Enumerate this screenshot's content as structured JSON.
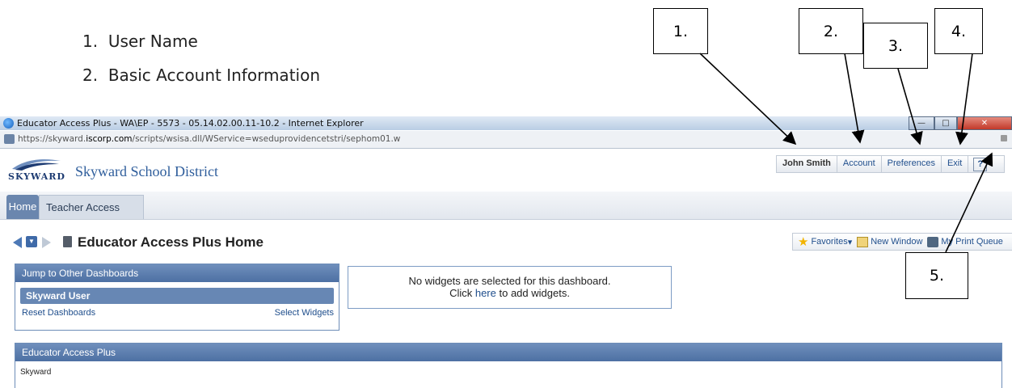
{
  "doc_list": [
    {
      "num": "1.",
      "text": "User Name"
    },
    {
      "num": "2.",
      "text": "Basic Account Information"
    }
  ],
  "callouts": [
    "1.",
    "2.",
    "3.",
    "4.",
    "5."
  ],
  "browser": {
    "title": "Educator Access Plus - WA\\EP - 5573 - 05.14.02.00.11-10.2 - Internet Explorer",
    "url_prefix": "https://skyward.",
    "url_domain": "iscorp.com",
    "url_path": "/scripts/wsisa.dll/WService=wseduprovidencetstri/sephom01.w"
  },
  "header": {
    "logo_text": "SKYWARD",
    "district": "Skyward School District",
    "user": "John Smith",
    "account": "Account",
    "preferences": "Preferences",
    "exit": "Exit",
    "help": "?"
  },
  "nav": {
    "tabs": [
      {
        "label": "Home"
      },
      {
        "label": "Teacher Access"
      }
    ]
  },
  "page": {
    "title": "Educator Access Plus Home",
    "actions": {
      "favorites": "Favorites",
      "new_window": "New Window",
      "print_queue": "My Print Queue"
    }
  },
  "jump_panel": {
    "title": "Jump to Other Dashboards",
    "selected": "Skyward User",
    "reset": "Reset Dashboards",
    "select_widgets": "Select Widgets"
  },
  "notice": {
    "line1": "No widgets are selected for this dashboard.",
    "click": "Click ",
    "here": "here",
    "rest": " to add widgets."
  },
  "section": {
    "title": "Educator Access Plus",
    "body": "Skyward"
  },
  "colors": {
    "accent": "#4d70a3",
    "link": "#1f4e8c"
  }
}
